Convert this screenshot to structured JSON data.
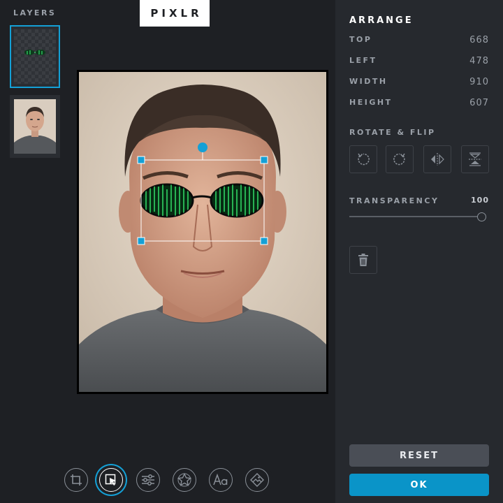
{
  "logo": "PIXLR",
  "layers": {
    "title": "LAYERS"
  },
  "arrange": {
    "title": "ARRANGE",
    "props": [
      {
        "label": "TOP",
        "value": "668"
      },
      {
        "label": "LEFT",
        "value": "478"
      },
      {
        "label": "WIDTH",
        "value": "910"
      },
      {
        "label": "HEIGHT",
        "value": "607"
      }
    ],
    "rotate_flip_label": "ROTATE & FLIP",
    "rotate_flip_buttons": [
      "rotate-left-icon",
      "rotate-right-icon",
      "flip-horizontal-icon",
      "flip-vertical-icon"
    ],
    "transparency_label": "TRANSPARENCY",
    "transparency_value": "100",
    "transparency_level": 1.0
  },
  "buttons": {
    "reset": "RESET",
    "ok": "OK"
  },
  "toolbar": {
    "tools": [
      "crop-icon",
      "arrange-icon",
      "adjust-icon",
      "sticker-icon",
      "text-icon",
      "photo-icon"
    ],
    "active": "arrange-icon"
  },
  "colors": {
    "accent": "#14a0d6",
    "ok_button": "#0a94c8",
    "panel": "#26292e",
    "background": "#1e2024"
  }
}
